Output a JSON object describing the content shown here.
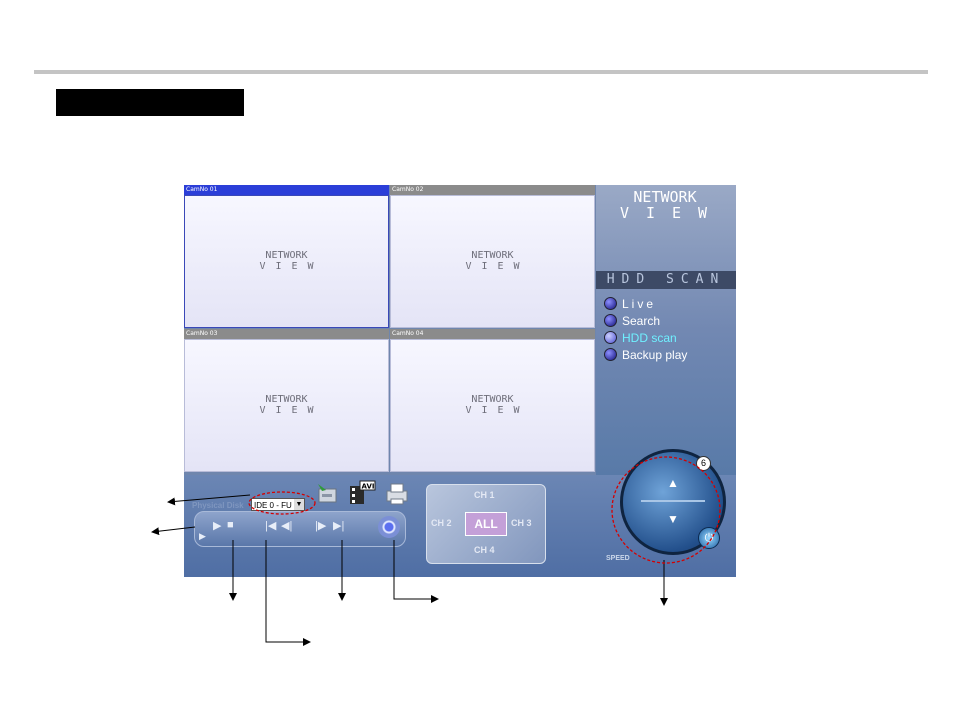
{
  "app": {
    "cameras": [
      {
        "title": "CamNo 01",
        "logo_line1": "NETWORK",
        "logo_line2": "VIEW",
        "active": true
      },
      {
        "title": "CamNo 02",
        "logo_line1": "NETWORK",
        "logo_line2": "VIEW",
        "active": false
      },
      {
        "title": "CamNo 03",
        "logo_line1": "NETWORK",
        "logo_line2": "VIEW",
        "active": false
      },
      {
        "title": "CamNo 04",
        "logo_line1": "NETWORK",
        "logo_line2": "VIEW",
        "active": false
      }
    ],
    "brand": {
      "line1": "NETWORK",
      "line2": "VIEW"
    },
    "mode_banner": "HDD SCAN",
    "menu": [
      {
        "label": "Live",
        "active": false
      },
      {
        "label": "Search",
        "active": false
      },
      {
        "label": "HDD scan",
        "active": true
      },
      {
        "label": "Backup play",
        "active": false
      }
    ],
    "physical_disk": {
      "label": "Physical Disk",
      "value": "IDE 0 - FU"
    },
    "avi_label": "AVI",
    "channels": {
      "ch1": "CH 1",
      "ch2": "CH 2",
      "ch3": "CH 3",
      "ch4": "CH 4",
      "all": "ALL"
    },
    "speed": {
      "label": "SPEED",
      "value": "6"
    },
    "colors": {
      "active_menu": "#6ff0ff",
      "active_cam_title": "#2b3ed8",
      "annotation_ring": "#d40000"
    }
  }
}
